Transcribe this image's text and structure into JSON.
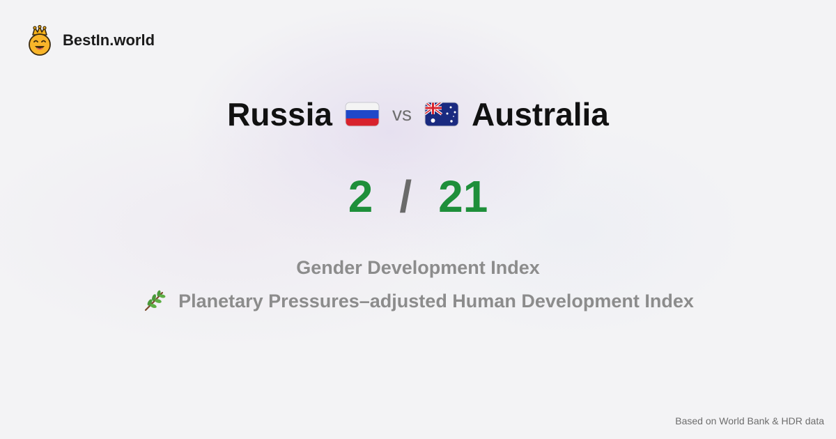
{
  "brand": {
    "name": "BestIn.world",
    "logo_icon": "crowned-smiley-icon"
  },
  "comparison": {
    "left_country": "Russia",
    "left_flag": "russia-flag-icon",
    "vs_label": "vs",
    "right_country": "Australia",
    "right_flag": "australia-flag-icon"
  },
  "scores": {
    "left": "2",
    "separator": "/",
    "right": "21",
    "color": "#1e8f3a"
  },
  "metrics": [
    {
      "label": "Gender Development Index",
      "icon": ""
    },
    {
      "label": "Planetary Pressures–adjusted Human Development Index",
      "icon": "branch-icon"
    }
  ],
  "footer": {
    "source": "Based on World Bank & HDR data"
  }
}
